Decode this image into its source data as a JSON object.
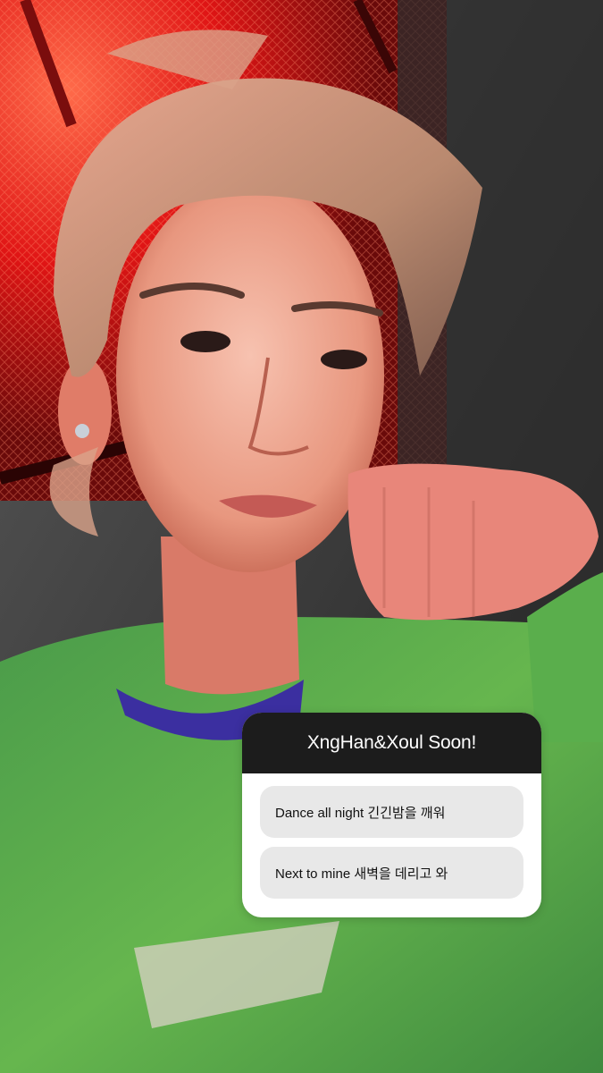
{
  "story": {
    "photo": {
      "subject": "selfie",
      "palette": {
        "red_light": "#ff2a2a",
        "wall_dark": "#2b2b2b",
        "shirt_green": "#5fb04a",
        "hair_blond": "#c99f7a"
      }
    },
    "quiz": {
      "title": "XngHan&Xoul Soon!",
      "options": [
        {
          "label": "Dance all night 긴긴밤을 깨워"
        },
        {
          "label": "Next to mine 새벽을 데리고 와"
        }
      ],
      "colors": {
        "header_bg": "#1c1c1c",
        "header_text": "#ffffff",
        "card_bg": "#ffffff",
        "option_bg": "#e8e8e8"
      }
    }
  }
}
